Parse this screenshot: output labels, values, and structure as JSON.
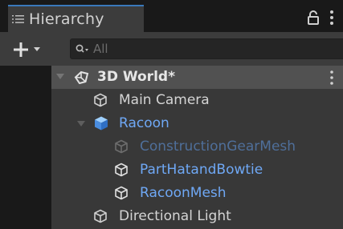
{
  "tab": {
    "title": "Hierarchy"
  },
  "search": {
    "placeholder": "All"
  },
  "tree": {
    "scene": {
      "label": "3D World*"
    },
    "items": [
      {
        "label": "Main Camera"
      },
      {
        "label": "Racoon"
      },
      {
        "label": "ConstructionGearMesh"
      },
      {
        "label": "PartHatandBowtie"
      },
      {
        "label": "RacoonMesh"
      },
      {
        "label": "Directional Light"
      }
    ]
  },
  "colors": {
    "accent": "#3a79bb",
    "prefab_blue": "#6fa8f5",
    "prefab_blue_dim": "#4f6f9a",
    "panel": "#383838",
    "selected_row": "#515151"
  }
}
